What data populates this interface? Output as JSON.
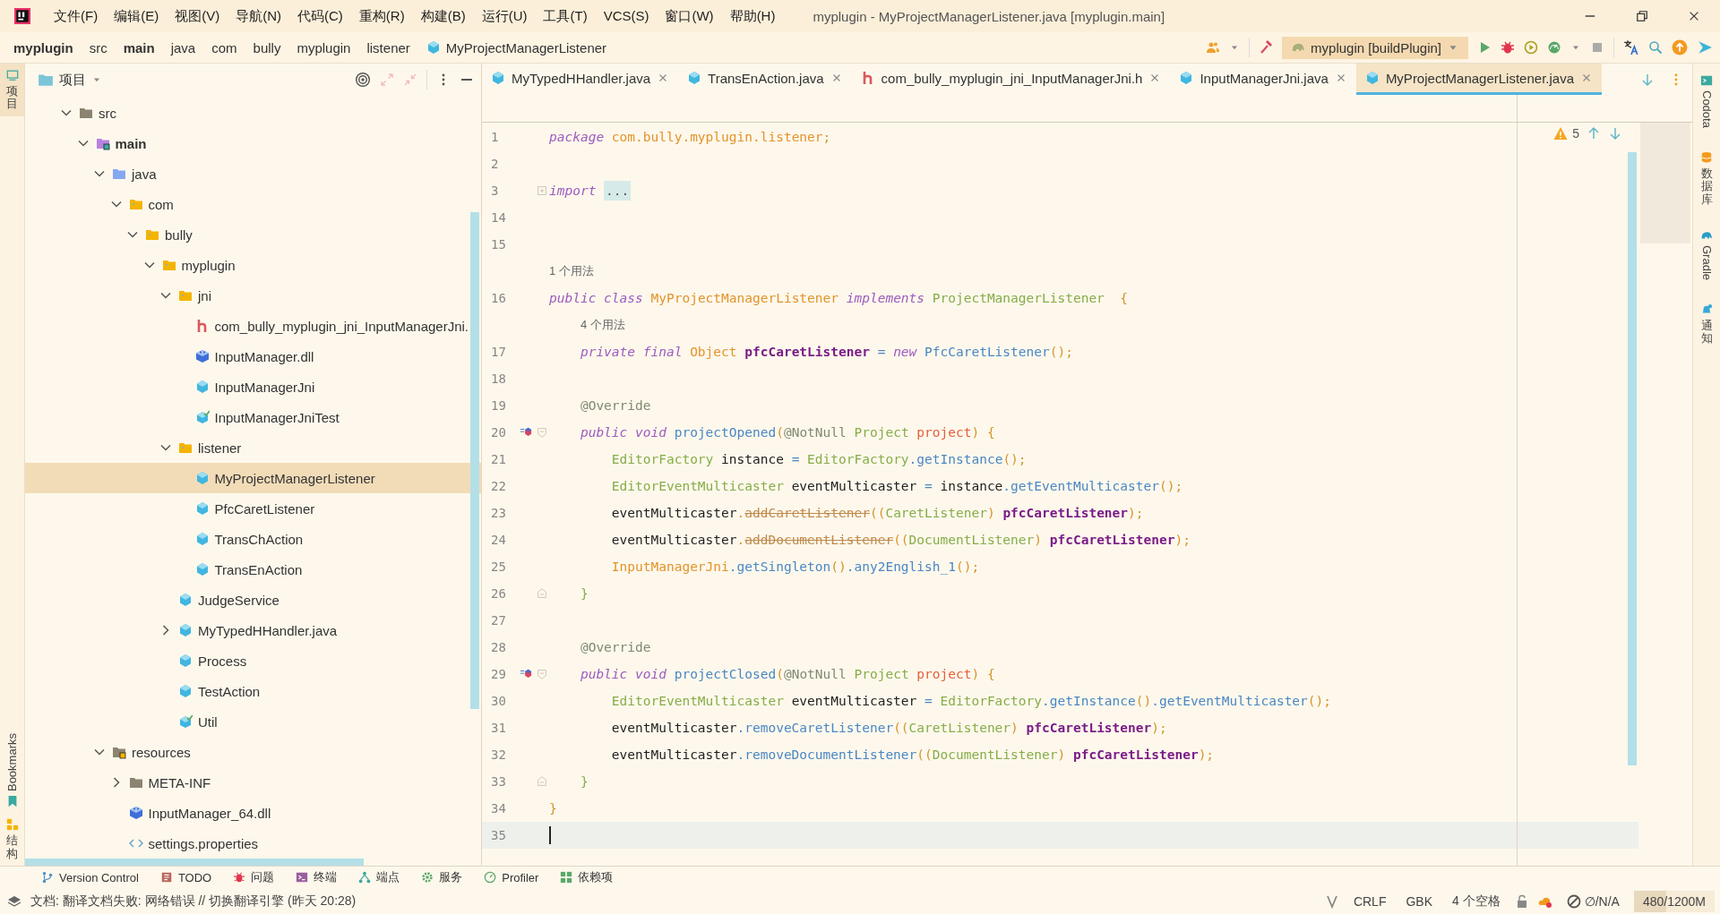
{
  "title_bar": {
    "menus": [
      "文件(F)",
      "编辑(E)",
      "视图(V)",
      "导航(N)",
      "代码(C)",
      "重构(R)",
      "构建(B)",
      "运行(U)",
      "工具(T)",
      "VCS(S)",
      "窗口(W)",
      "帮助(H)"
    ],
    "title": "myplugin - MyProjectManagerListener.java [myplugin.main]"
  },
  "nav_bar": {
    "breadcrumbs": [
      {
        "label": "myplugin",
        "kind": "project"
      },
      {
        "label": "src",
        "kind": "folder"
      },
      {
        "label": "main",
        "kind": "source_root"
      },
      {
        "label": "java",
        "kind": "folder"
      },
      {
        "label": "com",
        "kind": "folder"
      },
      {
        "label": "bully",
        "kind": "folder"
      },
      {
        "label": "myplugin",
        "kind": "folder"
      },
      {
        "label": "listener",
        "kind": "folder"
      },
      {
        "label": "MyProjectManagerListener",
        "kind": "class"
      }
    ],
    "run_config": {
      "label": "myplugin [buildPlugin]"
    }
  },
  "left_stripe": [
    {
      "label": "项目",
      "kind": "stacked",
      "selected": true
    },
    {
      "label": "Bookmarks",
      "kind": "rotated",
      "selected": false
    },
    {
      "label": "结构",
      "kind": "stacked",
      "selected": false
    }
  ],
  "project": {
    "title": "项目",
    "tree": [
      {
        "label": "src",
        "kind": "folder",
        "expanded": true,
        "selected": false,
        "children": [
          {
            "label": "main",
            "kind": "source_root",
            "expanded": true,
            "selected": false,
            "children": [
              {
                "label": "java",
                "kind": "java_root",
                "expanded": true,
                "selected": false,
                "children": [
                  {
                    "label": "com",
                    "kind": "package",
                    "expanded": true,
                    "selected": false,
                    "children": [
                      {
                        "label": "bully",
                        "kind": "package",
                        "expanded": true,
                        "selected": false,
                        "children": [
                          {
                            "label": "myplugin",
                            "kind": "package",
                            "expanded": true,
                            "selected": false,
                            "children": [
                              {
                                "label": "jni",
                                "kind": "package",
                                "expanded": true,
                                "selected": false,
                                "children": [
                                  {
                                    "label": "com_bully_myplugin_jni_InputManagerJni.",
                                    "kind": "header",
                                    "selected": false
                                  },
                                  {
                                    "label": "InputManager.dll",
                                    "kind": "library",
                                    "selected": false
                                  },
                                  {
                                    "label": "InputManagerJni",
                                    "kind": "class",
                                    "selected": false
                                  },
                                  {
                                    "label": "InputManagerJniTest",
                                    "kind": "test_class",
                                    "selected": false
                                  }
                                ]
                              },
                              {
                                "label": "listener",
                                "kind": "package",
                                "expanded": true,
                                "selected": false,
                                "children": [
                                  {
                                    "label": "MyProjectManagerListener",
                                    "kind": "class",
                                    "selected": true
                                  },
                                  {
                                    "label": "PfcCaretListener",
                                    "kind": "class",
                                    "selected": false
                                  },
                                  {
                                    "label": "TransChAction",
                                    "kind": "class",
                                    "selected": false
                                  },
                                  {
                                    "label": "TransEnAction",
                                    "kind": "class",
                                    "selected": false
                                  }
                                ]
                              },
                              {
                                "label": "JudgeService",
                                "kind": "class",
                                "selected": false
                              },
                              {
                                "label": "MyTypedHHandler.java",
                                "kind": "class",
                                "expanded": false,
                                "selected": false
                              },
                              {
                                "label": "Process",
                                "kind": "class",
                                "selected": false
                              },
                              {
                                "label": "TestAction",
                                "kind": "class",
                                "selected": false
                              },
                              {
                                "label": "Util",
                                "kind": "test_class",
                                "selected": false
                              }
                            ]
                          }
                        ]
                      }
                    ]
                  }
                ]
              },
              {
                "label": "resources",
                "kind": "resources_root",
                "expanded": true,
                "selected": false,
                "children": [
                  {
                    "label": "META-INF",
                    "kind": "folder",
                    "expanded": false,
                    "selected": false
                  },
                  {
                    "label": "InputManager_64.dll",
                    "kind": "library",
                    "selected": false
                  },
                  {
                    "label": "settings.properties",
                    "kind": "properties",
                    "selected": false
                  }
                ]
              }
            ]
          }
        ]
      }
    ]
  },
  "editor": {
    "tabs": [
      {
        "label": "MyTypedHHandler.java",
        "kind": "class",
        "selected": false
      },
      {
        "label": "TransEnAction.java",
        "kind": "class",
        "selected": false
      },
      {
        "label": "com_bully_myplugin_jni_InputManagerJni.h",
        "kind": "header",
        "selected": false
      },
      {
        "label": "InputManagerJni.java",
        "kind": "class",
        "selected": false
      },
      {
        "label": "MyProjectManagerListener.java",
        "kind": "class",
        "selected": true
      }
    ],
    "warnings": "5",
    "lines": [
      {
        "number": "1",
        "tokens": [
          {
            "kind": "kw",
            "text": "package "
          },
          {
            "kind": "pkg",
            "text": "com.bully.myplugin.listener"
          },
          {
            "kind": "punct",
            "text": ";"
          }
        ]
      },
      {
        "number": "2"
      },
      {
        "number": "3",
        "collapsed": true,
        "tokens": [
          {
            "kind": "kw",
            "text": "import "
          },
          {
            "kind": "folded",
            "text": "..."
          }
        ]
      },
      {
        "number": "14"
      },
      {
        "number": "15"
      },
      {
        "number": "16",
        "hint": "1 个用法",
        "tokens": [
          {
            "kind": "kw",
            "text": "public class "
          },
          {
            "kind": "cls",
            "text": "MyProjectManagerListener "
          },
          {
            "kind": "kw",
            "text": "implements "
          },
          {
            "kind": "type",
            "text": "ProjectManagerListener  "
          },
          {
            "kind": "punct",
            "text": "{"
          }
        ]
      },
      {
        "number": "17",
        "hint": "4 个用法",
        "tokens": [
          {
            "kind": "kw",
            "text": "    private final "
          },
          {
            "kind": "cls",
            "text": "Object "
          },
          {
            "kind": "fld",
            "text": "pfcCaretListener "
          },
          {
            "kind": "op",
            "text": "= "
          },
          {
            "kind": "kw",
            "text": "new "
          },
          {
            "kind": "ctor",
            "text": "PfcCaretListener"
          },
          {
            "kind": "punct",
            "text": "();"
          }
        ]
      },
      {
        "number": "18"
      },
      {
        "number": "19",
        "tokens": [
          {
            "kind": "ann",
            "text": "    @Override"
          }
        ]
      },
      {
        "number": "20",
        "marker": true,
        "fold_start": true,
        "tokens": [
          {
            "kind": "kw",
            "text": "    public void "
          },
          {
            "kind": "mth",
            "text": "projectOpened"
          },
          {
            "kind": "punct",
            "text": "("
          },
          {
            "kind": "ann",
            "text": "@NotNull "
          },
          {
            "kind": "type",
            "text": "Project "
          },
          {
            "kind": "param",
            "text": "project"
          },
          {
            "kind": "punct",
            "text": ") {"
          }
        ]
      },
      {
        "number": "21",
        "tokens": [
          {
            "kind": "type",
            "text": "        EditorFactory "
          },
          {
            "kind": "id",
            "text": "instance "
          },
          {
            "kind": "op",
            "text": "= "
          },
          {
            "kind": "type",
            "text": "EditorFactory"
          },
          {
            "kind": "mth",
            "text": ".getInstance"
          },
          {
            "kind": "punct",
            "text": "();"
          }
        ]
      },
      {
        "number": "22",
        "tokens": [
          {
            "kind": "type",
            "text": "        EditorEventMulticaster "
          },
          {
            "kind": "id",
            "text": "eventMulticaster "
          },
          {
            "kind": "op",
            "text": "= "
          },
          {
            "kind": "id",
            "text": "instance"
          },
          {
            "kind": "mth",
            "text": ".getEventMulticaster"
          },
          {
            "kind": "punct",
            "text": "();"
          }
        ]
      },
      {
        "number": "23",
        "tokens": [
          {
            "kind": "id",
            "text": "        eventMulticaster"
          },
          {
            "kind": "punct",
            "text": "."
          },
          {
            "kind": "dep",
            "text": "addCaretListener"
          },
          {
            "kind": "punct",
            "text": "(("
          },
          {
            "kind": "type",
            "text": "CaretListener"
          },
          {
            "kind": "punct",
            "text": ") "
          },
          {
            "kind": "fld",
            "text": "pfcCaretListener"
          },
          {
            "kind": "punct",
            "text": ");"
          }
        ]
      },
      {
        "number": "24",
        "tokens": [
          {
            "kind": "id",
            "text": "        eventMulticaster"
          },
          {
            "kind": "punct",
            "text": "."
          },
          {
            "kind": "dep",
            "text": "addDocumentListener"
          },
          {
            "kind": "punct",
            "text": "(("
          },
          {
            "kind": "type",
            "text": "DocumentListener"
          },
          {
            "kind": "punct",
            "text": ") "
          },
          {
            "kind": "fld",
            "text": "pfcCaretListener"
          },
          {
            "kind": "punct",
            "text": ");"
          }
        ]
      },
      {
        "number": "25",
        "tokens": [
          {
            "kind": "cls",
            "text": "        InputManagerJni"
          },
          {
            "kind": "mth",
            "text": ".getSingleton"
          },
          {
            "kind": "punct",
            "text": "()"
          },
          {
            "kind": "mth",
            "text": ".any2English_1"
          },
          {
            "kind": "punct",
            "text": "();"
          }
        ]
      },
      {
        "number": "26",
        "fold_end": true,
        "tokens": [
          {
            "kind": "type",
            "text": "    }"
          }
        ]
      },
      {
        "number": "27"
      },
      {
        "number": "28",
        "tokens": [
          {
            "kind": "ann",
            "text": "    @Override"
          }
        ]
      },
      {
        "number": "29",
        "marker": true,
        "fold_start": true,
        "tokens": [
          {
            "kind": "kw",
            "text": "    public void "
          },
          {
            "kind": "mth",
            "text": "projectClosed"
          },
          {
            "kind": "punct",
            "text": "("
          },
          {
            "kind": "ann",
            "text": "@NotNull "
          },
          {
            "kind": "type",
            "text": "Project "
          },
          {
            "kind": "param",
            "text": "project"
          },
          {
            "kind": "punct",
            "text": ") {"
          }
        ]
      },
      {
        "number": "30",
        "tokens": [
          {
            "kind": "type",
            "text": "        EditorEventMulticaster "
          },
          {
            "kind": "id",
            "text": "eventMulticaster "
          },
          {
            "kind": "op",
            "text": "= "
          },
          {
            "kind": "type",
            "text": "EditorFactory"
          },
          {
            "kind": "mth",
            "text": ".getInstance"
          },
          {
            "kind": "punct",
            "text": "()"
          },
          {
            "kind": "mth",
            "text": ".getEventMulticaster"
          },
          {
            "kind": "punct",
            "text": "();"
          }
        ]
      },
      {
        "number": "31",
        "tokens": [
          {
            "kind": "id",
            "text": "        eventMulticaster"
          },
          {
            "kind": "mth",
            "text": ".removeCaretListener"
          },
          {
            "kind": "punct",
            "text": "(("
          },
          {
            "kind": "type",
            "text": "CaretListener"
          },
          {
            "kind": "punct",
            "text": ") "
          },
          {
            "kind": "fld",
            "text": "pfcCaretListener"
          },
          {
            "kind": "punct",
            "text": ");"
          }
        ]
      },
      {
        "number": "32",
        "tokens": [
          {
            "kind": "id",
            "text": "        eventMulticaster"
          },
          {
            "kind": "mth",
            "text": ".removeDocumentListener"
          },
          {
            "kind": "punct",
            "text": "(("
          },
          {
            "kind": "type",
            "text": "DocumentListener"
          },
          {
            "kind": "punct",
            "text": ") "
          },
          {
            "kind": "fld",
            "text": "pfcCaretListener"
          },
          {
            "kind": "punct",
            "text": ");"
          }
        ]
      },
      {
        "number": "33",
        "fold_end": true,
        "tokens": [
          {
            "kind": "type",
            "text": "    }"
          }
        ]
      },
      {
        "number": "34",
        "tokens": [
          {
            "kind": "punct",
            "text": "}"
          }
        ]
      },
      {
        "number": "35",
        "current": true
      }
    ]
  },
  "right_stripe": [
    {
      "label": "Codota",
      "kind": "rotated"
    },
    {
      "label": "数据库",
      "kind": "stacked"
    },
    {
      "label": "Gradle",
      "kind": "rotated"
    },
    {
      "label": "通知",
      "kind": "stacked"
    }
  ],
  "tool_windows": [
    "Version Control",
    "TODO",
    "问题",
    "终端",
    "端点",
    "服务",
    "Profiler",
    "依赖项"
  ],
  "status_bar": {
    "message": "文档: 翻译文档失败: 网络错误 // 切换翻译引擎 (昨天 20:28)",
    "items": [
      "CRLF",
      "GBK",
      "4 个空格"
    ],
    "inspection": "∅/N/A",
    "memory": {
      "text": "480/1200M",
      "level": 0.4
    }
  }
}
